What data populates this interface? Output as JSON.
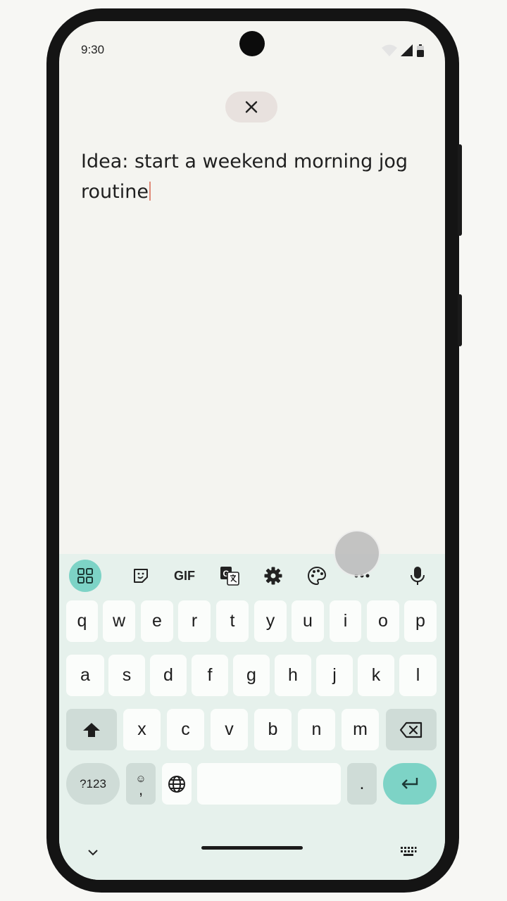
{
  "status_bar": {
    "time": "9:30"
  },
  "note": {
    "text": "Idea: start a weekend morning jog routine"
  },
  "keyboard": {
    "toolbar": [
      "apps-grid-icon",
      "sticker-icon",
      "GIF",
      "translate-icon",
      "settings-gear-icon",
      "palette-icon",
      "more-icon",
      "mic-icon"
    ],
    "gif_label": "GIF",
    "row1": [
      "q",
      "w",
      "e",
      "r",
      "t",
      "y",
      "u",
      "i",
      "o",
      "p"
    ],
    "row2": [
      "a",
      "s",
      "d",
      "f",
      "g",
      "h",
      "j",
      "k",
      "l"
    ],
    "row3": [
      "x",
      "c",
      "v",
      "b",
      "n",
      "m"
    ],
    "symbols_label": "?123",
    "comma_label": ",",
    "period_label": ".",
    "accent_color": "#7dd3c6"
  }
}
